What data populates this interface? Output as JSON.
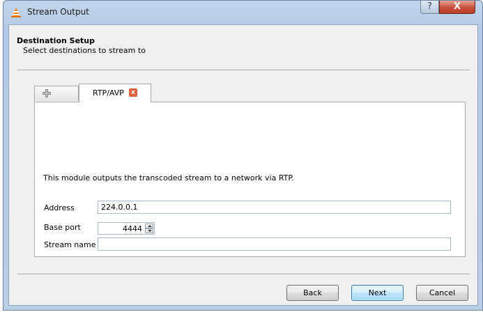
{
  "window": {
    "title": "Stream Output",
    "help_glyph": "?",
    "close_glyph": "X"
  },
  "header": {
    "title": "Destination Setup",
    "subtitle": "Select destinations to stream to"
  },
  "tabs": {
    "add_icon": "plus-icon",
    "active_label": "RTP/AVP",
    "close_glyph": "x"
  },
  "panel": {
    "description": "This module outputs the transcoded stream to a network via RTP.",
    "address": {
      "label": "Address",
      "value": "224.0.0.1"
    },
    "base_port": {
      "label": "Base port",
      "value": "4444"
    },
    "stream_name": {
      "label": "Stream name",
      "value": ""
    }
  },
  "buttons": {
    "back": "Back",
    "next": "Next",
    "cancel": "Cancel"
  },
  "colors": {
    "titlebar": "#b9cde7",
    "close_button": "#c7503d",
    "client_bg": "#f0f0f0",
    "tab_close": "#e0603b",
    "default_button": "#bee6fd"
  }
}
